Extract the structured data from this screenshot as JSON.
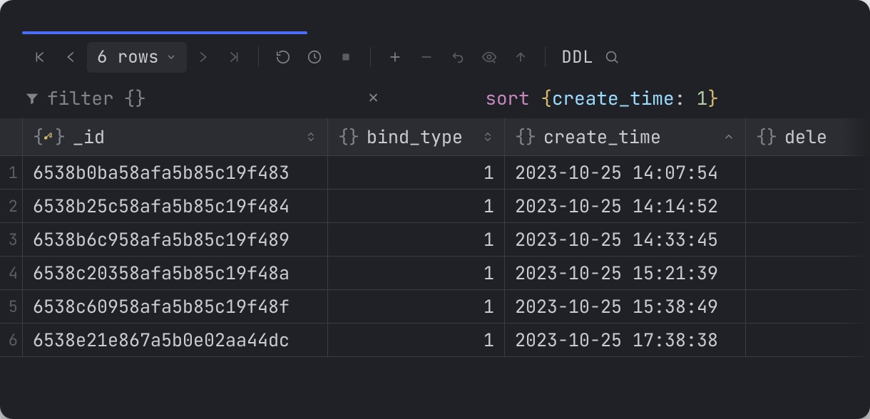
{
  "toolbar": {
    "rows_label": "6 rows",
    "ddl_label": "DDL"
  },
  "filter": {
    "label": "filter",
    "expr": "{}"
  },
  "sort": {
    "keyword": "sort",
    "open": "{",
    "field": "create_time",
    "sep": ": ",
    "value": "1",
    "close": "}"
  },
  "columns": {
    "id": "_id",
    "bind_type": "bind_type",
    "create_time": "create_time",
    "delete": "dele"
  },
  "rows": [
    {
      "n": "1",
      "_id": "6538b0ba58afa5b85c19f483",
      "bind_type": "1",
      "create_time": "2023-10-25 14:07:54"
    },
    {
      "n": "2",
      "_id": "6538b25c58afa5b85c19f484",
      "bind_type": "1",
      "create_time": "2023-10-25 14:14:52"
    },
    {
      "n": "3",
      "_id": "6538b6c958afa5b85c19f489",
      "bind_type": "1",
      "create_time": "2023-10-25 14:33:45"
    },
    {
      "n": "4",
      "_id": "6538c20358afa5b85c19f48a",
      "bind_type": "1",
      "create_time": "2023-10-25 15:21:39"
    },
    {
      "n": "5",
      "_id": "6538c60958afa5b85c19f48f",
      "bind_type": "1",
      "create_time": "2023-10-25 15:38:49"
    },
    {
      "n": "6",
      "_id": "6538e21e867a5b0e02aa44dc",
      "bind_type": "1",
      "create_time": "2023-10-25 17:38:38"
    }
  ]
}
